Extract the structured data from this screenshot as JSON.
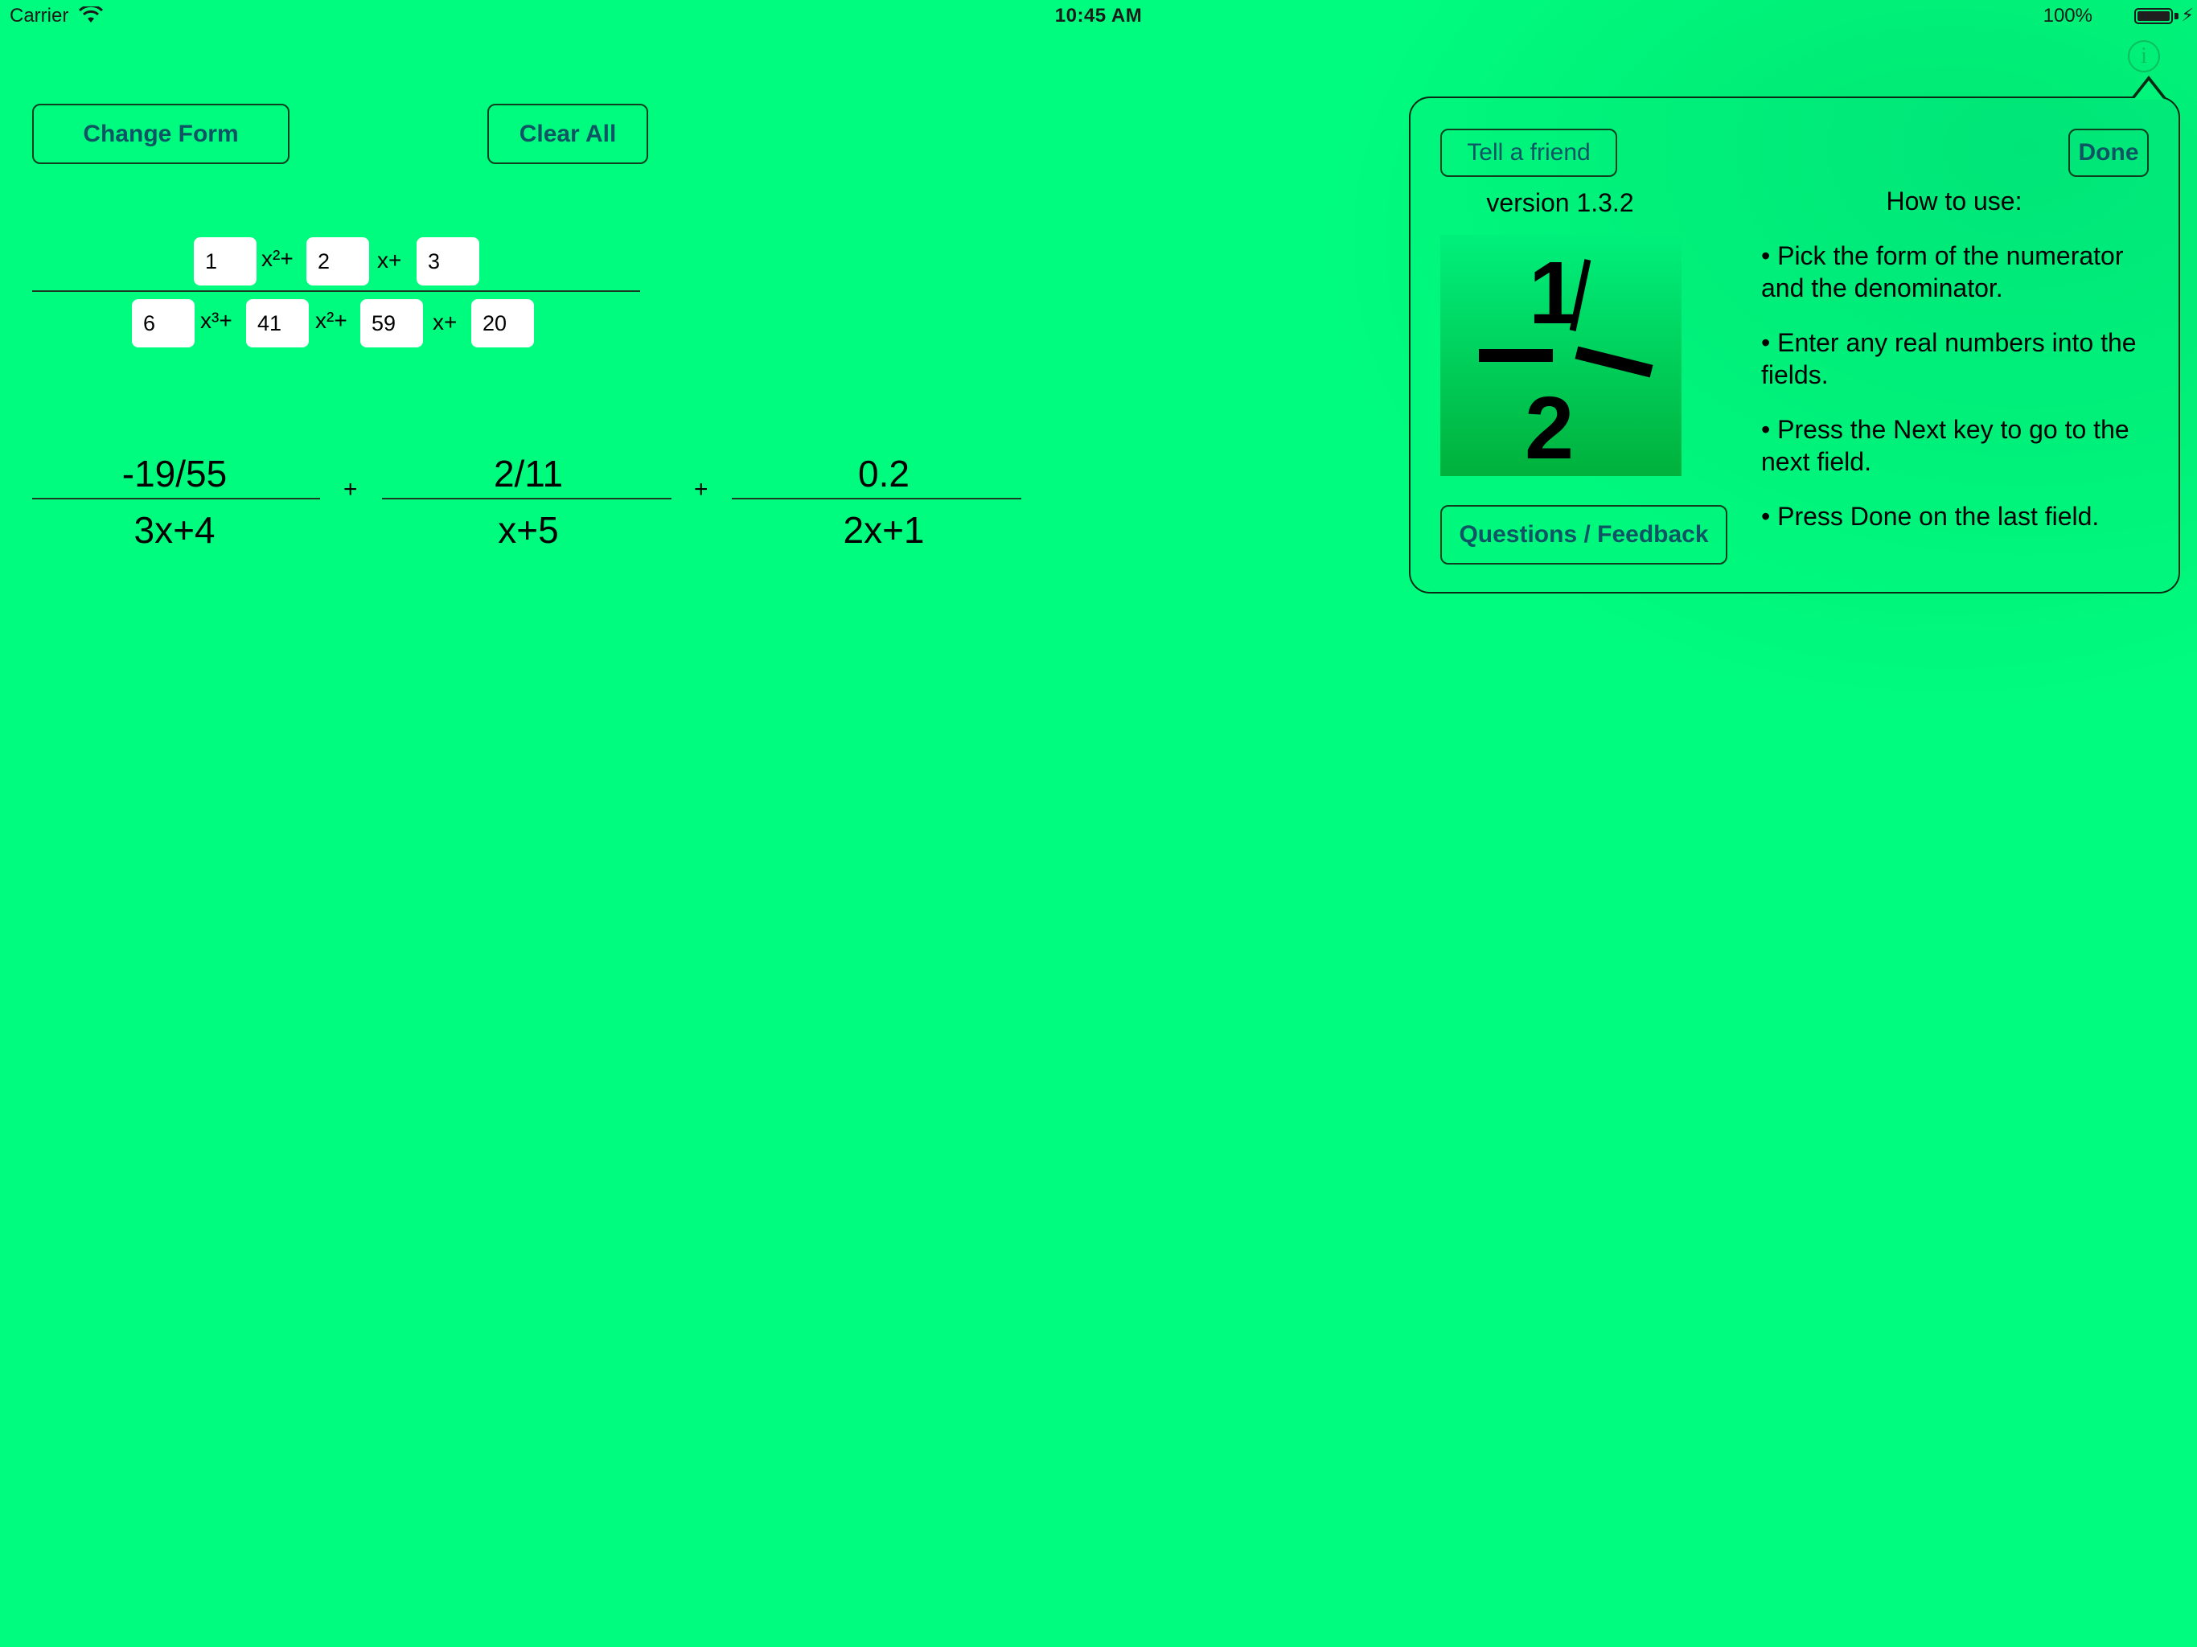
{
  "status_bar": {
    "carrier": "Carrier",
    "time": "10:45 AM",
    "battery_percent": "100%"
  },
  "toolbar": {
    "change_form_label": "Change Form",
    "clear_all_label": "Clear All"
  },
  "numerator": {
    "coefficients": [
      "1",
      "2",
      "3"
    ],
    "terms": [
      "x²+",
      "x+"
    ]
  },
  "denominator": {
    "coefficients": [
      "6",
      "41",
      "59",
      "20"
    ],
    "terms": [
      "x³+",
      "x²+",
      "x+"
    ]
  },
  "result": {
    "fractions": [
      {
        "numerator": "-19/55",
        "denominator": "3x+4"
      },
      {
        "numerator": "2/11",
        "denominator": "x+5"
      },
      {
        "numerator": "0.2",
        "denominator": "2x+1"
      }
    ],
    "operator": "+"
  },
  "popover": {
    "tell_friend_label": "Tell a friend",
    "done_label": "Done",
    "version": "version 1.3.2",
    "feedback_label": "Questions / Feedback",
    "howto_title": "How to use:",
    "instructions": [
      "• Pick the form of the numerator and the denominator.",
      "• Enter any real numbers into the fields.",
      "• Press the Next key to go to the next field.",
      "• Press Done on the last field."
    ],
    "logo_text": {
      "numerator": "1",
      "denominator": "2"
    }
  },
  "icons": {
    "info": "info-icon",
    "wifi": "wifi-icon",
    "battery": "battery-icon"
  },
  "colors": {
    "background": "#00fc7e",
    "button_text": "#0e5564",
    "button_border": "#0e3f1e"
  }
}
